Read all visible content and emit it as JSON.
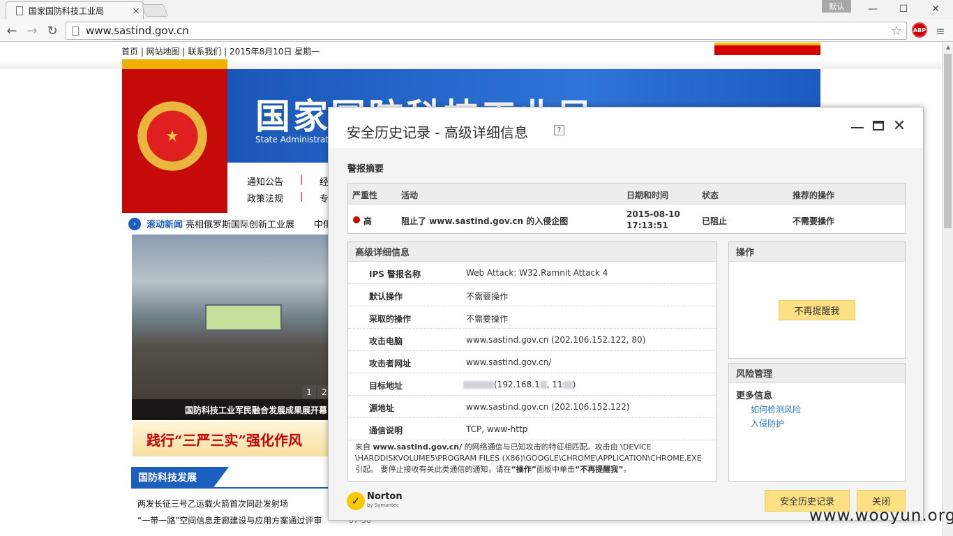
{
  "browser": {
    "tab_title": "国家国防科技工业局",
    "tab_close": "×",
    "profile": "默认",
    "url": "www.sastind.gov.cn",
    "abp": "ABP",
    "icons": {
      "back": "←",
      "forward": "→",
      "reload": "↻",
      "star": "☆",
      "menu": "≡",
      "minimize": "—",
      "maximize": "☐",
      "close": "✕"
    }
  },
  "site": {
    "topnav": "首页 | 网站地图 | 联系我们 |  2015年8月10日 星期一",
    "banner_title": "国家国防科技工业局",
    "banner_sub": "State Administration",
    "menu": [
      "通知公告",
      "经",
      "政策法规",
      "专"
    ],
    "menu_sep": "|",
    "ticker_label": "滚动新闻",
    "ticker_text": "亮相俄罗斯国际创新工业展",
    "ticker_text2": "中俄",
    "photo_caption": "国防科技工业军民融合发展成果展开幕",
    "pager": [
      "1",
      "2"
    ],
    "slogan": "践行“三严三实”强化作风",
    "section_title": "国防科技发展",
    "news": [
      "两发长征三号乙运载火箭首次同赴发射场",
      "“一带一路”空间信息走廊建设与应用方案通过评审"
    ],
    "news_dates": [
      "07-30"
    ]
  },
  "dialog": {
    "title": "安全历史记录 - 高级详细信息",
    "help": "?",
    "summary_label": "警报摘要",
    "columns": [
      "严重性",
      "活动",
      "日期和时间",
      "状态",
      "推荐的操作"
    ],
    "alert": {
      "severity": "高",
      "activity": "阻止了 www.sastind.gov.cn 的入侵企图",
      "date": "2015-08-10",
      "time": "17:13:51",
      "status": "已阻止",
      "recommended": "不需要操作"
    },
    "severity_color": "#cc0000",
    "details_title": "高级详细信息",
    "details": [
      {
        "label": "IPS 警报名称",
        "value": "Web Attack: W32.Ramnit Attack 4"
      },
      {
        "label": "默认操作",
        "value": "不需要操作"
      },
      {
        "label": "采取的操作",
        "value": "不需要操作"
      },
      {
        "label": "攻击电脑",
        "value": "www.sastind.gov.cn (202.106.152.122, 80)"
      },
      {
        "label": "攻击者网址",
        "value": "www.sastind.gov.cn/"
      },
      {
        "label": "目标地址",
        "value_a": "(192.168.1",
        "value_b": ", 11",
        "value_c": ")"
      },
      {
        "label": "源地址",
        "value": "www.sastind.gov.cn (202.106.152.122)"
      },
      {
        "label": "通信说明",
        "value": "TCP, www-http"
      }
    ],
    "description": {
      "p1": "来自 ",
      "b1": "www.sastind.gov.cn/",
      "p2": " 的网络通信与已知攻击的特征相匹配。攻击由 \\DEVICE \\HARDDISKVOLUME5\\PROGRAM FILES (X86)\\GOOGLE\\CHROME\\APPLICATION\\CHROME.EXE 引起。 要停止接收有关此类通信的通知，请在",
      "b2": "“操作”",
      "p3": "面板中单击",
      "b3": "“不再提醒我”",
      "p4": "。"
    },
    "actions_title": "操作",
    "dont_remind": "不再提醒我",
    "risk_title": "风险管理",
    "more_info": "更多信息",
    "links": [
      "如何检测风险",
      "入侵防护"
    ],
    "norton_brand": "Norton",
    "norton_by": "by Symantec",
    "norton_check": "✓",
    "history_button": "安全历史记录",
    "close_button": "关闭",
    "accent": "#fddf84",
    "link_color": "#2a78c4"
  },
  "watermark": "www.wooyun.org"
}
